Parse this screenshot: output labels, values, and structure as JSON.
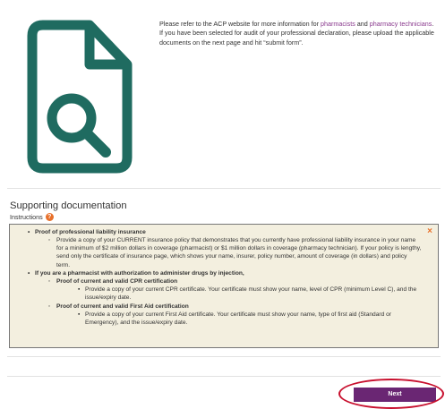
{
  "intro": {
    "text_before": "Please refer to the ACP website for more information for ",
    "link_pharmacists": "pharmacists",
    "text_and": " and ",
    "link_technicians": "pharmacy technicians",
    "text_after": ". If you have been selected for audit of your professional declaration, please upload the applicable documents on the next page and hit “submit form”."
  },
  "section": {
    "title": "Supporting documentation",
    "instructions_label": "Instructions",
    "help_icon": "?"
  },
  "instructions_box": {
    "close_icon": "×",
    "item1": "Proof of professional liability insurance",
    "item1_sub": "Provide a copy of your CURRENT insurance policy that demonstrates that you currently have professional liability insurance in your name for a minimum of $2 million dollars in coverage (pharmacist) or $1 million dollars in coverage (pharmacy technician). If your policy is lengthy, send only the certificate of insurance page, which shows your name, insurer, policy number, amount of coverage (in dollars) and policy term.",
    "item2": "If you are a pharmacist with authorization to administer drugs by injection,",
    "item2_sub1": "Proof of current and valid CPR certification",
    "item2_sub1_detail": "Provide a copy of your current CPR certificate. Your certificate must show your name, level of CPR (minimum Level C), and the issue/expiry date.",
    "item2_sub2": "Proof of current and valid First Aid certification",
    "item2_sub2_detail": "Provide a copy of your current First Aid certificate. Your certificate must show your name, type of first aid (Standard or Emergency), and the issue/expiry date."
  },
  "footer": {
    "next_label": "Next"
  },
  "colors": {
    "icon_teal": "#1f6b60",
    "link_purple": "#8a3a8e",
    "button_purple": "#6a2673",
    "accent_orange": "#e8702a",
    "box_background": "#f3efdf",
    "highlight_red": "#c8102e"
  },
  "icons": {
    "document": "document-search-icon",
    "help": "help-circle-icon",
    "close": "close-icon"
  }
}
